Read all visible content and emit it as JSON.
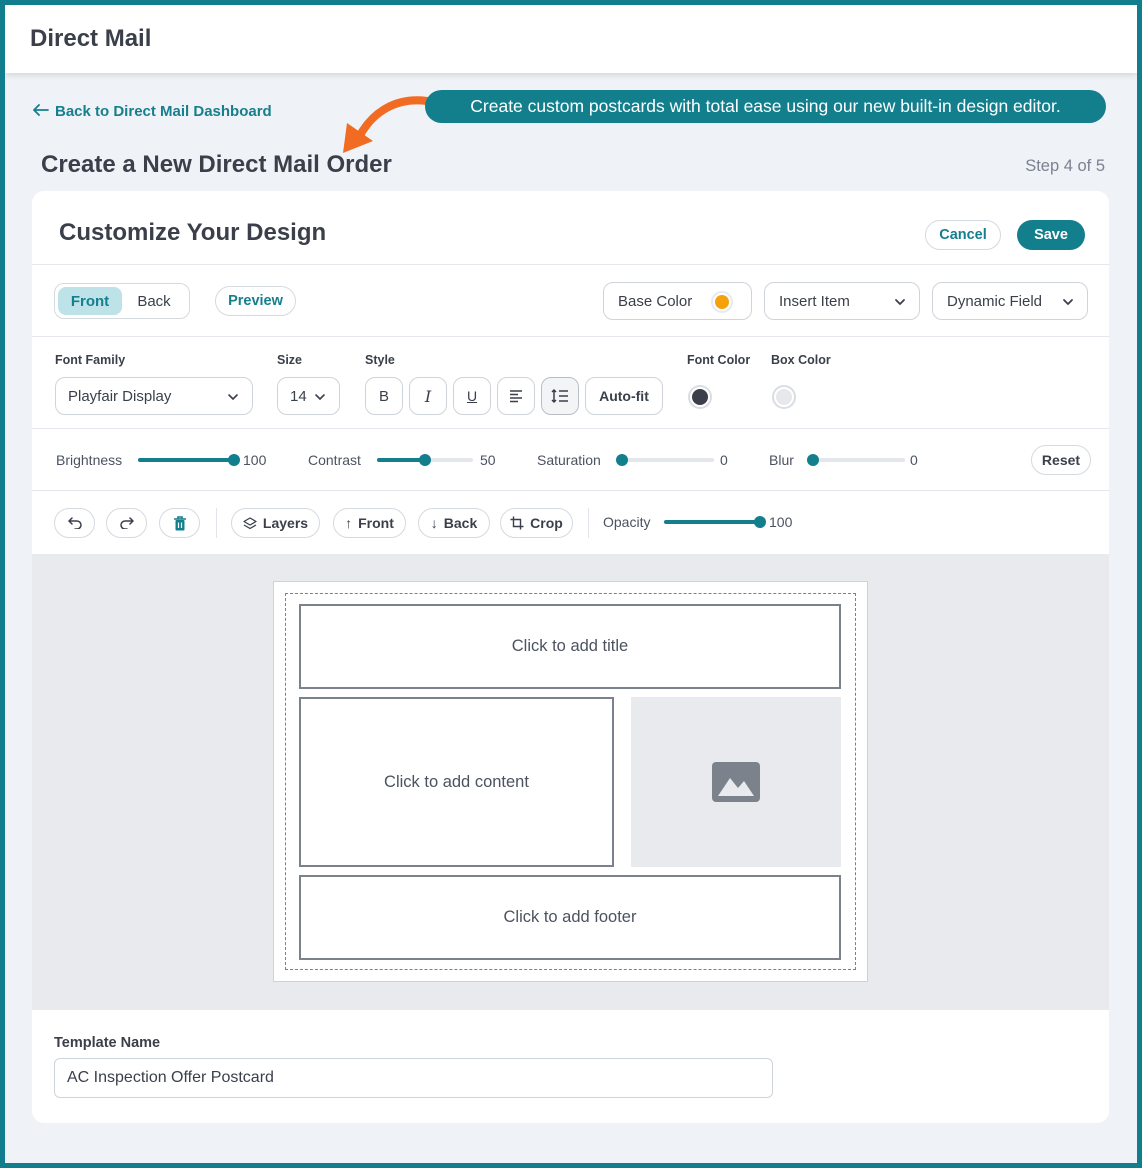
{
  "app": {
    "title": "Direct Mail"
  },
  "nav": {
    "back_link": "Back to Direct Mail Dashboard"
  },
  "callout": {
    "text": "Create custom postcards with total ease using our new built-in design editor."
  },
  "page": {
    "title": "Create a New Direct Mail Order",
    "step": "Step 4 of 5"
  },
  "card": {
    "title": "Customize Your Design",
    "cancel": "Cancel",
    "save": "Save"
  },
  "sides": {
    "front": "Front",
    "back": "Back",
    "active": "Front"
  },
  "toolbar1": {
    "preview": "Preview",
    "base_color_label": "Base Color",
    "base_color_value": "#f5a20a",
    "insert_item": "Insert Item",
    "dynamic_field": "Dynamic Field"
  },
  "text_controls": {
    "font_family_label": "Font Family",
    "font_family_value": "Playfair Display",
    "size_label": "Size",
    "size_value": "14",
    "style_label": "Style",
    "bold_glyph": "B",
    "italic_glyph": "I",
    "underline_glyph": "U",
    "auto_fit": "Auto-fit",
    "font_color_label": "Font Color",
    "font_color_value": "#3b3f4a",
    "box_color_label": "Box Color",
    "box_color_value": "#e6e8eb"
  },
  "adjustments": {
    "brightness": {
      "label": "Brightness",
      "value": "100",
      "fraction": 1.0
    },
    "contrast": {
      "label": "Contrast",
      "value": "50",
      "fraction": 0.5
    },
    "saturation": {
      "label": "Saturation",
      "value": "0",
      "fraction": 0.0
    },
    "blur": {
      "label": "Blur",
      "value": "0",
      "fraction": 0.0
    },
    "reset": "Reset"
  },
  "arrange": {
    "layers": "Layers",
    "front": "Front",
    "back": "Back",
    "crop": "Crop",
    "opacity_label": "Opacity",
    "opacity_value": "100",
    "opacity_fraction": 1.0
  },
  "postcard": {
    "title_placeholder": "Click to add title",
    "content_placeholder": "Click to add content",
    "footer_placeholder": "Click to add footer"
  },
  "template": {
    "label": "Template Name",
    "value": "AC Inspection Offer Postcard"
  },
  "icons": {
    "back_arrow": "arrow-left-icon",
    "undo": "undo-icon",
    "redo": "redo-icon",
    "delete": "trash-icon",
    "image": "image-icon"
  },
  "colors": {
    "accent": "#137f8d",
    "callout_arrow": "#f26b22"
  }
}
